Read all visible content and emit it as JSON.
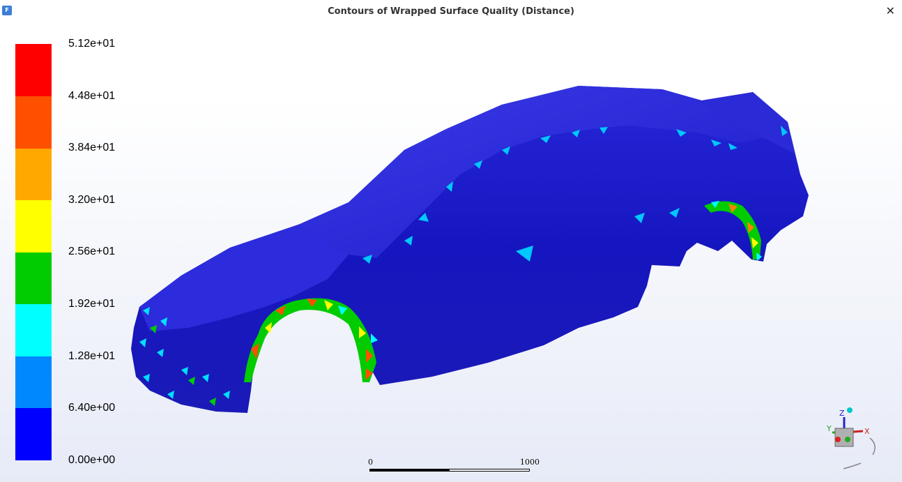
{
  "window": {
    "title": "Contours of Wrapped Surface Quality (Distance)",
    "app_icon": "F",
    "close_label": "✕"
  },
  "colorbar": {
    "labels": [
      "5.12e+01",
      "4.48e+01",
      "3.84e+01",
      "3.20e+01",
      "2.56e+01",
      "1.92e+01",
      "1.28e+01",
      "6.40e+00",
      "0.00e+00"
    ],
    "colors": [
      "#ff0000",
      "#ff5000",
      "#ffa800",
      "#ffff00",
      "#00cc00",
      "#00ffff",
      "#0088ff",
      "#0000ff"
    ]
  },
  "scale": {
    "start": "0",
    "end": "1000"
  },
  "triad": {
    "x": "X",
    "y": "Y",
    "z": "Z"
  }
}
